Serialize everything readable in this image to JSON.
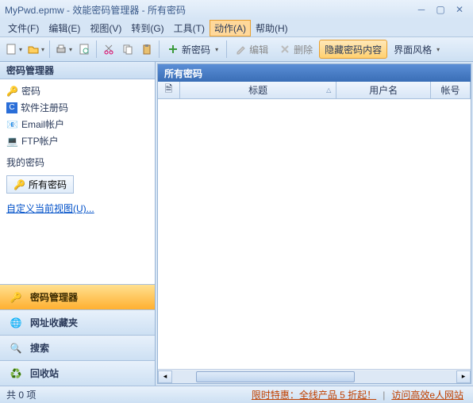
{
  "window": {
    "title": "MyPwd.epmw - 效能密码管理器 - 所有密码"
  },
  "menubar": {
    "file": "文件(F)",
    "edit": "编辑(E)",
    "view": "视图(V)",
    "goto": "转到(G)",
    "tool": "工具(T)",
    "action": "动作(A)",
    "help": "帮助(H)"
  },
  "toolbar": {
    "new_password": "新密码",
    "edit_btn": "编辑",
    "delete_btn": "删除",
    "hide_content": "隐藏密码内容",
    "skin": "界面风格"
  },
  "sidebar": {
    "header": "密码管理器",
    "tree": {
      "pwd": "密码",
      "software": "软件注册码",
      "email": "Email帐户",
      "ftp": "FTP帐户"
    },
    "my_pwd_label": "我的密码",
    "all_pwd_btn": "所有密码",
    "custom_view": "自定义当前视图(U)...",
    "nav": {
      "manager": "密码管理器",
      "favorites": "网址收藏夹",
      "search": "搜索",
      "recycle": "回收站"
    }
  },
  "content": {
    "header": "所有密码",
    "columns": {
      "icon": "",
      "title": "标题",
      "user": "用户名",
      "account": "帐号"
    }
  },
  "statusbar": {
    "count": "共 0 项",
    "promo": "限时特惠：全线产品 5 折起！",
    "visit": "访问高效e人网站"
  }
}
